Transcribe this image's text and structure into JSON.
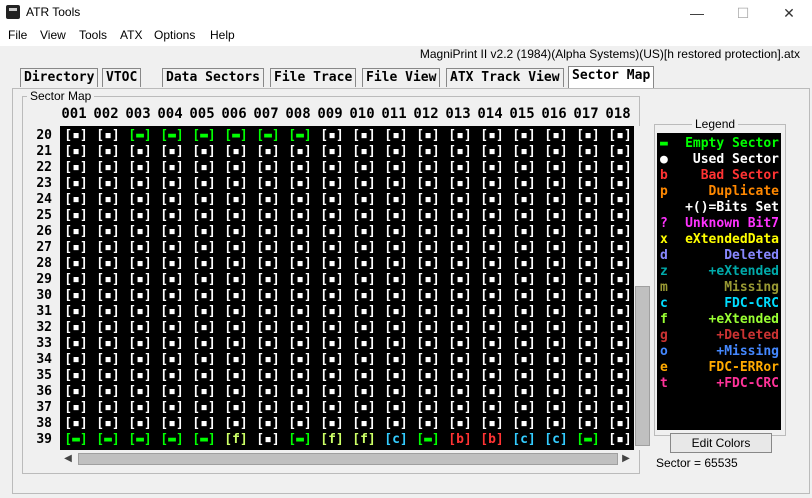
{
  "window": {
    "title": "ATR Tools",
    "minimize": "—",
    "maximize": "☐",
    "close": "✕"
  },
  "menu": [
    "File",
    "View",
    "Tools",
    "ATX",
    "Options",
    "Help"
  ],
  "filename": "MagniPrint II v2.2 (1984)(Alpha Systems)(US)[h restored protection].atx",
  "tabs": [
    {
      "label": "Directory",
      "active": false
    },
    {
      "label": "VTOC",
      "active": false
    },
    {
      "label": "Data Sectors",
      "active": false
    },
    {
      "label": "File Trace",
      "active": false
    },
    {
      "label": "File View",
      "active": false
    },
    {
      "label": "ATX Track View",
      "active": false
    },
    {
      "label": "Sector Map",
      "active": true
    }
  ],
  "sector_map": {
    "label": "Sector Map",
    "columns": [
      "001",
      "002",
      "003",
      "004",
      "005",
      "006",
      "007",
      "008",
      "009",
      "010",
      "011",
      "012",
      "013",
      "014",
      "015",
      "016",
      "017",
      "018"
    ],
    "rows": [
      {
        "track": "20",
        "cells": [
          "u",
          "u",
          "e",
          "e",
          "e",
          "e",
          "e",
          "e",
          "u",
          "u",
          "u",
          "u",
          "u",
          "u",
          "u",
          "u",
          "u",
          "u"
        ]
      },
      {
        "track": "21",
        "cells": [
          "u",
          "u",
          "u",
          "u",
          "u",
          "u",
          "u",
          "u",
          "u",
          "u",
          "u",
          "u",
          "u",
          "u",
          "u",
          "u",
          "u",
          "u"
        ]
      },
      {
        "track": "22",
        "cells": [
          "u",
          "u",
          "u",
          "u",
          "u",
          "u",
          "u",
          "u",
          "u",
          "u",
          "u",
          "u",
          "u",
          "u",
          "u",
          "u",
          "u",
          "u"
        ]
      },
      {
        "track": "23",
        "cells": [
          "u",
          "u",
          "u",
          "u",
          "u",
          "u",
          "u",
          "u",
          "u",
          "u",
          "u",
          "u",
          "u",
          "u",
          "u",
          "u",
          "u",
          "u"
        ]
      },
      {
        "track": "24",
        "cells": [
          "u",
          "u",
          "u",
          "u",
          "u",
          "u",
          "u",
          "u",
          "u",
          "u",
          "u",
          "u",
          "u",
          "u",
          "u",
          "u",
          "u",
          "u"
        ]
      },
      {
        "track": "25",
        "cells": [
          "u",
          "u",
          "u",
          "u",
          "u",
          "u",
          "u",
          "u",
          "u",
          "u",
          "u",
          "u",
          "u",
          "u",
          "u",
          "u",
          "u",
          "u"
        ]
      },
      {
        "track": "26",
        "cells": [
          "u",
          "u",
          "u",
          "u",
          "u",
          "u",
          "u",
          "u",
          "u",
          "u",
          "u",
          "u",
          "u",
          "u",
          "u",
          "u",
          "u",
          "u"
        ]
      },
      {
        "track": "27",
        "cells": [
          "u",
          "u",
          "u",
          "u",
          "u",
          "u",
          "u",
          "u",
          "u",
          "u",
          "u",
          "u",
          "u",
          "u",
          "u",
          "u",
          "u",
          "u"
        ]
      },
      {
        "track": "28",
        "cells": [
          "u",
          "u",
          "u",
          "u",
          "u",
          "u",
          "u",
          "u",
          "u",
          "u",
          "u",
          "u",
          "u",
          "u",
          "u",
          "u",
          "u",
          "u"
        ]
      },
      {
        "track": "29",
        "cells": [
          "u",
          "u",
          "u",
          "u",
          "u",
          "u",
          "u",
          "u",
          "u",
          "u",
          "u",
          "u",
          "u",
          "u",
          "u",
          "u",
          "u",
          "u"
        ]
      },
      {
        "track": "30",
        "cells": [
          "u",
          "u",
          "u",
          "u",
          "u",
          "u",
          "u",
          "u",
          "u",
          "u",
          "u",
          "u",
          "u",
          "u",
          "u",
          "u",
          "u",
          "u"
        ]
      },
      {
        "track": "31",
        "cells": [
          "u",
          "u",
          "u",
          "u",
          "u",
          "u",
          "u",
          "u",
          "u",
          "u",
          "u",
          "u",
          "u",
          "u",
          "u",
          "u",
          "u",
          "u"
        ]
      },
      {
        "track": "32",
        "cells": [
          "u",
          "u",
          "u",
          "u",
          "u",
          "u",
          "u",
          "u",
          "u",
          "u",
          "u",
          "u",
          "u",
          "u",
          "u",
          "u",
          "u",
          "u"
        ]
      },
      {
        "track": "33",
        "cells": [
          "u",
          "u",
          "u",
          "u",
          "u",
          "u",
          "u",
          "u",
          "u",
          "u",
          "u",
          "u",
          "u",
          "u",
          "u",
          "u",
          "u",
          "u"
        ]
      },
      {
        "track": "34",
        "cells": [
          "u",
          "u",
          "u",
          "u",
          "u",
          "u",
          "u",
          "u",
          "u",
          "u",
          "u",
          "u",
          "u",
          "u",
          "u",
          "u",
          "u",
          "u"
        ]
      },
      {
        "track": "35",
        "cells": [
          "u",
          "u",
          "u",
          "u",
          "u",
          "u",
          "u",
          "u",
          "u",
          "u",
          "u",
          "u",
          "u",
          "u",
          "u",
          "u",
          "u",
          "u"
        ]
      },
      {
        "track": "36",
        "cells": [
          "u",
          "u",
          "u",
          "u",
          "u",
          "u",
          "u",
          "u",
          "u",
          "u",
          "u",
          "u",
          "u",
          "u",
          "u",
          "u",
          "u",
          "u"
        ]
      },
      {
        "track": "37",
        "cells": [
          "u",
          "u",
          "u",
          "u",
          "u",
          "u",
          "u",
          "u",
          "u",
          "u",
          "u",
          "u",
          "u",
          "u",
          "u",
          "u",
          "u",
          "u"
        ]
      },
      {
        "track": "38",
        "cells": [
          "u",
          "u",
          "u",
          "u",
          "u",
          "u",
          "u",
          "u",
          "u",
          "u",
          "u",
          "u",
          "u",
          "u",
          "u",
          "u",
          "u",
          "u"
        ]
      },
      {
        "track": "39",
        "cells": [
          "e",
          "e",
          "e",
          "e",
          "e",
          "f",
          "u",
          "e",
          "f",
          "f",
          "c",
          "e",
          "b",
          "b",
          "c",
          "c",
          "e",
          "u"
        ]
      }
    ],
    "cell_text": {
      "u": "[▪]",
      "e": "[▬]",
      "f": "[f]",
      "c": "[c]",
      "b": "[b]"
    },
    "cell_colors": {
      "u": "#ffffff",
      "e": "#00ff00",
      "f": "#ccff66",
      "c": "#33ccff",
      "b": "#ff3333"
    }
  },
  "legend": {
    "title": "Legend",
    "items": [
      {
        "symbol": "▬",
        "text": "Empty Sector",
        "symbol_color": "#00ff00",
        "color": "#00ff00"
      },
      {
        "symbol": "●",
        "text": "Used Sector",
        "symbol_color": "#ffffff",
        "color": "#ffffff"
      },
      {
        "symbol": "b",
        "text": "Bad Sector",
        "symbol_color": "#ff3333",
        "color": "#ff3333"
      },
      {
        "symbol": "p",
        "text": "Duplicate",
        "symbol_color": "#ff8800",
        "color": "#ff8800"
      },
      {
        "symbol": "",
        "text": "+()=Bits Set",
        "symbol_color": "#ffffff",
        "color": "#ffffff"
      },
      {
        "symbol": "?",
        "text": "Unknown Bit7",
        "symbol_color": "#ff33ff",
        "color": "#ff33ff"
      },
      {
        "symbol": "x",
        "text": "eXtendedData",
        "symbol_color": "#ffff00",
        "color": "#ffff00"
      },
      {
        "symbol": "d",
        "text": "Deleted",
        "symbol_color": "#8888ff",
        "color": "#8888ff"
      },
      {
        "symbol": "z",
        "text": "+eXtended",
        "symbol_color": "#00aaaa",
        "color": "#00aaaa"
      },
      {
        "symbol": "m",
        "text": "Missing",
        "symbol_color": "#999933",
        "color": "#999933"
      },
      {
        "symbol": "c",
        "text": "FDC-CRC",
        "symbol_color": "#00ddff",
        "color": "#00ddff"
      },
      {
        "symbol": "f",
        "text": "+eXtended",
        "symbol_color": "#99ff33",
        "color": "#99ff33"
      },
      {
        "symbol": "g",
        "text": "+Deleted",
        "symbol_color": "#cc3333",
        "color": "#cc3333"
      },
      {
        "symbol": "o",
        "text": "+Missing",
        "symbol_color": "#4488ff",
        "color": "#4488ff"
      },
      {
        "symbol": "e",
        "text": "FDC-ERRor",
        "symbol_color": "#ffaa00",
        "color": "#ffaa00"
      },
      {
        "symbol": "t",
        "text": "+FDC-CRC",
        "symbol_color": "#ff3399",
        "color": "#ff3399"
      }
    ],
    "edit_button": "Edit Colors"
  },
  "status": {
    "sector_readout": "Sector = 65535"
  }
}
